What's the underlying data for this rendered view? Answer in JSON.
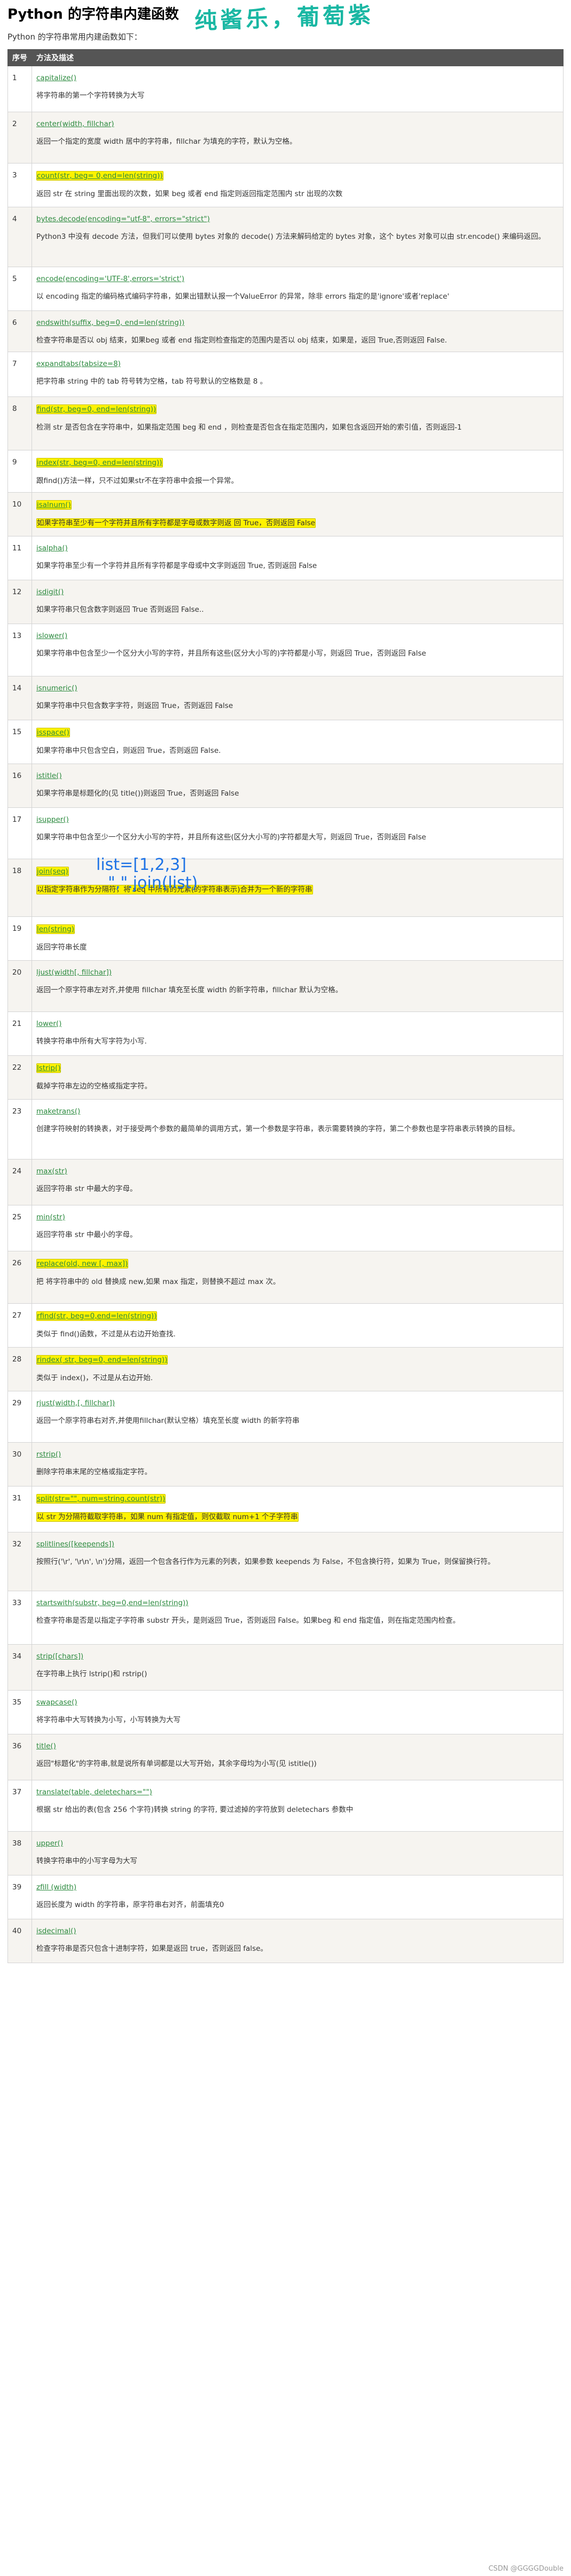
{
  "page": {
    "title": "Python 的字符串内建函数",
    "handwritten_note": "纯酱乐，葡萄紫",
    "intro": "Python 的字符串常用内建函数如下：",
    "header_num": "序号",
    "header_desc": "方法及描述",
    "footer": "CSDN @GGGGDouble"
  },
  "annotation": {
    "line1": "list=[1,2,3]",
    "line2": "\",\".join(list)"
  },
  "rows": [
    {
      "n": "1",
      "fn": "capitalize()",
      "desc": "将字符串的第一个字符转换为大写",
      "fn_hl": false,
      "desc_hl": false
    },
    {
      "n": "2",
      "fn": "center(width, fillchar)",
      "desc": "返回一个指定的宽度 width 居中的字符串，fillchar 为填充的字符，默认为空格。",
      "fn_hl": false,
      "desc_hl": false
    },
    {
      "n": "3",
      "fn": "count(str, beg= 0,end=len(string))",
      "desc": "返回 str 在 string 里面出现的次数，如果 beg 或者 end 指定则返回指定范围内 str 出现的次数",
      "fn_hl": true,
      "desc_hl": false
    },
    {
      "n": "4",
      "fn": "bytes.decode(encoding=\"utf-8\", errors=\"strict\")",
      "desc": "Python3 中没有 decode 方法，但我们可以使用 bytes 对象的 decode() 方法来解码给定的 bytes 对象，这个 bytes 对象可以由 str.encode() 来编码返回。",
      "fn_hl": false,
      "desc_hl": false
    },
    {
      "n": "5",
      "fn": "encode(encoding='UTF-8',errors='strict')",
      "desc": "以 encoding 指定的编码格式编码字符串，如果出错默认报一个ValueError 的异常，除非 errors 指定的是'ignore'或者'replace'",
      "fn_hl": false,
      "desc_hl": false
    },
    {
      "n": "6",
      "fn": "endswith(suffix, beg=0, end=len(string))",
      "desc": "检查字符串是否以 obj 结束，如果beg 或者 end 指定则检查指定的范围内是否以 obj 结束，如果是，返回 True,否则返回 False.",
      "fn_hl": false,
      "desc_hl": false
    },
    {
      "n": "7",
      "fn": "expandtabs(tabsize=8)",
      "desc": "把字符串 string 中的 tab 符号转为空格，tab 符号默认的空格数是 8 。",
      "fn_hl": false,
      "desc_hl": false
    },
    {
      "n": "8",
      "fn": "find(str, beg=0, end=len(string))",
      "desc": "检测 str 是否包含在字符串中，如果指定范围 beg 和 end ，则检查是否包含在指定范围内，如果包含返回开始的索引值，否则返回-1",
      "fn_hl": true,
      "desc_hl": false
    },
    {
      "n": "9",
      "fn": "index(str, beg=0, end=len(string))",
      "desc": "跟find()方法一样，只不过如果str不在字符串中会报一个异常。",
      "fn_hl": true,
      "desc_hl": false
    },
    {
      "n": "10",
      "fn": "isalnum()",
      "desc": "如果字符串至少有一个字符并且所有字符都是字母或数字则返 回 True，否则返回 False",
      "fn_hl": true,
      "desc_hl": true
    },
    {
      "n": "11",
      "fn": "isalpha()",
      "desc": "如果字符串至少有一个字符并且所有字符都是字母或中文字则返回 True, 否则返回 False",
      "fn_hl": false,
      "desc_hl": false
    },
    {
      "n": "12",
      "fn": "isdigit()",
      "desc": "如果字符串只包含数字则返回 True 否则返回 False..",
      "fn_hl": false,
      "desc_hl": false
    },
    {
      "n": "13",
      "fn": "islower()",
      "desc": "如果字符串中包含至少一个区分大小写的字符，并且所有这些(区分大小写的)字符都是小写，则返回 True，否则返回 False",
      "fn_hl": false,
      "desc_hl": false
    },
    {
      "n": "14",
      "fn": "isnumeric()",
      "desc": "如果字符串中只包含数字字符，则返回 True，否则返回 False",
      "fn_hl": false,
      "desc_hl": false
    },
    {
      "n": "15",
      "fn": "isspace()",
      "desc": "如果字符串中只包含空白，则返回 True，否则返回 False.",
      "fn_hl": true,
      "desc_hl": false
    },
    {
      "n": "16",
      "fn": "istitle()",
      "desc": "如果字符串是标题化的(见 title())则返回 True，否则返回 False",
      "fn_hl": false,
      "desc_hl": false
    },
    {
      "n": "17",
      "fn": "isupper()",
      "desc": "如果字符串中包含至少一个区分大小写的字符，并且所有这些(区分大小写的)字符都是大写，则返回 True，否则返回 False",
      "fn_hl": false,
      "desc_hl": false
    },
    {
      "n": "18",
      "fn": "join(seq)",
      "desc": "以指定字符串作为分隔符，将 seq 中所有的元素(的字符串表示)合并为一个新的字符串",
      "fn_hl": true,
      "desc_hl": true
    },
    {
      "n": "19",
      "fn": "len(string)",
      "desc": "返回字符串长度",
      "fn_hl": true,
      "desc_hl": false
    },
    {
      "n": "20",
      "fn": "ljust(width[, fillchar])",
      "desc": "返回一个原字符串左对齐,并使用 fillchar 填充至长度 width 的新字符串，fillchar 默认为空格。",
      "fn_hl": false,
      "desc_hl": false
    },
    {
      "n": "21",
      "fn": "lower()",
      "desc": "转换字符串中所有大写字符为小写.",
      "fn_hl": false,
      "desc_hl": false
    },
    {
      "n": "22",
      "fn": "lstrip()",
      "desc": "截掉字符串左边的空格或指定字符。",
      "fn_hl": true,
      "desc_hl": false
    },
    {
      "n": "23",
      "fn": "maketrans()",
      "desc": "创建字符映射的转换表，对于接受两个参数的最简单的调用方式，第一个参数是字符串，表示需要转换的字符，第二个参数也是字符串表示转换的目标。",
      "fn_hl": false,
      "desc_hl": false
    },
    {
      "n": "24",
      "fn": "max(str)",
      "desc": "返回字符串 str 中最大的字母。",
      "fn_hl": false,
      "desc_hl": false
    },
    {
      "n": "25",
      "fn": "min(str)",
      "desc": "返回字符串 str 中最小的字母。",
      "fn_hl": false,
      "desc_hl": false
    },
    {
      "n": "26",
      "fn": "replace(old, new [, max])",
      "desc": "把 将字符串中的 old 替换成 new,如果 max 指定，则替换不超过 max 次。",
      "fn_hl": true,
      "desc_hl": false
    },
    {
      "n": "27",
      "fn": "rfind(str, beg=0,end=len(string))",
      "desc": "类似于 find()函数，不过是从右边开始查找.",
      "fn_hl": true,
      "desc_hl": false
    },
    {
      "n": "28",
      "fn": "rindex( str, beg=0, end=len(string))",
      "desc": "类似于 index()，不过是从右边开始.",
      "fn_hl": true,
      "desc_hl": false
    },
    {
      "n": "29",
      "fn": "rjust(width,[, fillchar])",
      "desc": "返回一个原字符串右对齐,并使用fillchar(默认空格）填充至长度 width 的新字符串",
      "fn_hl": false,
      "desc_hl": false
    },
    {
      "n": "30",
      "fn": "rstrip()",
      "desc": "删除字符串末尾的空格或指定字符。",
      "fn_hl": false,
      "desc_hl": false
    },
    {
      "n": "31",
      "fn": "split(str=\"\", num=string.count(str))",
      "desc": "以 str 为分隔符截取字符串，如果 num 有指定值，则仅截取 num+1 个子字符串",
      "fn_hl": true,
      "desc_hl": true
    },
    {
      "n": "32",
      "fn": "splitlines([keepends])",
      "desc": "按照行('\\r', '\\r\\n', \\n')分隔，返回一个包含各行作为元素的列表，如果参数 keepends 为 False，不包含换行符，如果为 True，则保留换行符。",
      "fn_hl": false,
      "desc_hl": false
    },
    {
      "n": "33",
      "fn": "startswith(substr, beg=0,end=len(string))",
      "desc": "检查字符串是否是以指定子字符串 substr 开头，是则返回 True，否则返回 False。如果beg 和 end 指定值，则在指定范围内检查。",
      "fn_hl": false,
      "desc_hl": false
    },
    {
      "n": "34",
      "fn": "strip([chars])",
      "desc": "在字符串上执行 lstrip()和 rstrip()",
      "fn_hl": false,
      "desc_hl": false
    },
    {
      "n": "35",
      "fn": "swapcase()",
      "desc": "将字符串中大写转换为小写，小写转换为大写",
      "fn_hl": false,
      "desc_hl": false
    },
    {
      "n": "36",
      "fn": "title()",
      "desc": "返回\"标题化\"的字符串,就是说所有单词都是以大写开始，其余字母均为小写(见 istitle())",
      "fn_hl": false,
      "desc_hl": false
    },
    {
      "n": "37",
      "fn": "translate(table, deletechars=\"\")",
      "desc": "根据 str 给出的表(包含 256 个字符)转换 string 的字符, 要过滤掉的字符放到 deletechars 参数中",
      "fn_hl": false,
      "desc_hl": false
    },
    {
      "n": "38",
      "fn": "upper()",
      "desc": "转换字符串中的小写字母为大写",
      "fn_hl": false,
      "desc_hl": false
    },
    {
      "n": "39",
      "fn": "zfill (width)",
      "desc": "返回长度为 width 的字符串，原字符串右对齐，前面填充0",
      "fn_hl": false,
      "desc_hl": false
    },
    {
      "n": "40",
      "fn": "isdecimal()",
      "desc": "检查字符串是否只包含十进制字符，如果是返回 true，否则返回 false。",
      "fn_hl": false,
      "desc_hl": false
    }
  ]
}
